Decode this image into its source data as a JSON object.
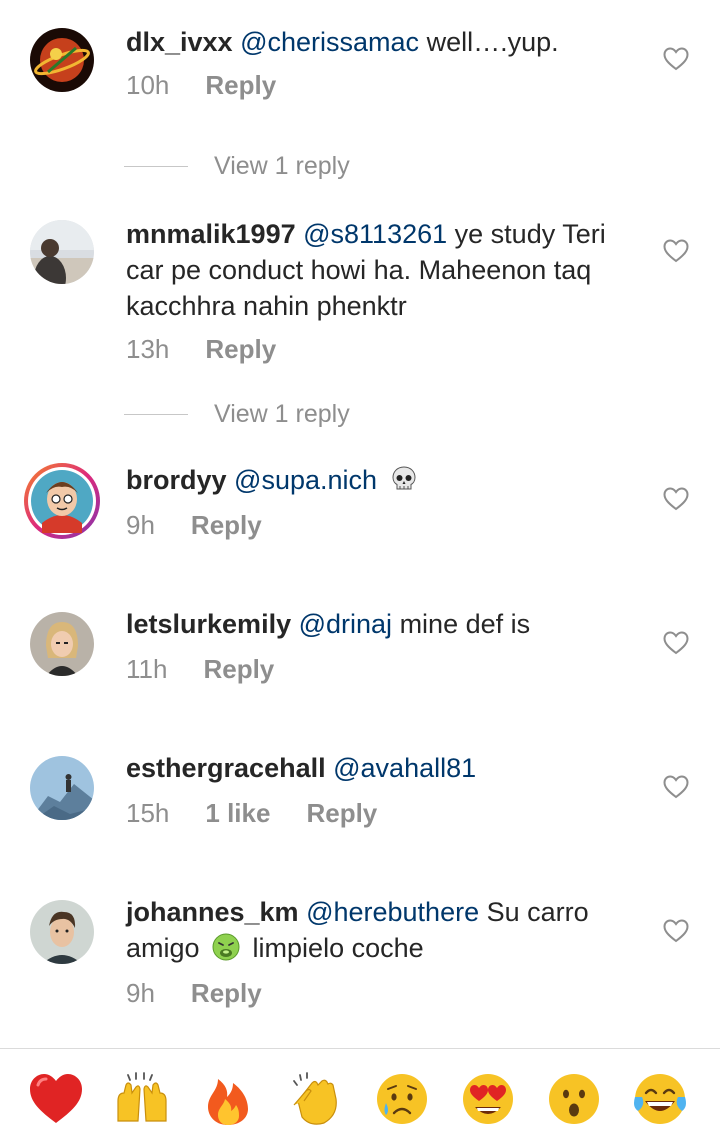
{
  "comments": [
    {
      "username": "dlx_ivxx",
      "mention": "@cherissamac",
      "text": " well….yup.",
      "time": "10h",
      "reply": "Reply"
    },
    {
      "username": "mnmalik1997",
      "mention": "@s8113261",
      "text": " ye study Teri car pe conduct howi ha. Maheenon taq kacchhra nahin phenktr",
      "time": "13h",
      "reply": "Reply"
    },
    {
      "username": "brordyy",
      "mention": "@supa.nich",
      "text": " ",
      "time": "9h",
      "reply": "Reply"
    },
    {
      "username": "letslurkemily",
      "mention": "@drinaj",
      "text": " mine def is",
      "time": "11h",
      "reply": "Reply"
    },
    {
      "username": "esthergracehall",
      "mention": "@avahall81",
      "text": "",
      "time": "15h",
      "likes": "1 like",
      "reply": "Reply"
    },
    {
      "username": "johannes_km",
      "mention": "@herebuthere",
      "text_before": " Su carro amigo ",
      "text_after": " limpielo coche",
      "time": "9h",
      "reply": "Reply"
    }
  ],
  "view_replies": [
    "View 1 reply",
    "View 1 reply"
  ],
  "inline_emojis": [
    "skull-emoji",
    "nauseated-face-emoji"
  ],
  "emoji_bar": [
    "red-heart",
    "raising-hands",
    "fire",
    "clapping-hands",
    "sad-face",
    "heart-eyes",
    "surprised-face",
    "tears-of-joy"
  ],
  "colors": {
    "mention": "#00376b",
    "secondary": "#8e8e8e",
    "text": "#262626"
  }
}
